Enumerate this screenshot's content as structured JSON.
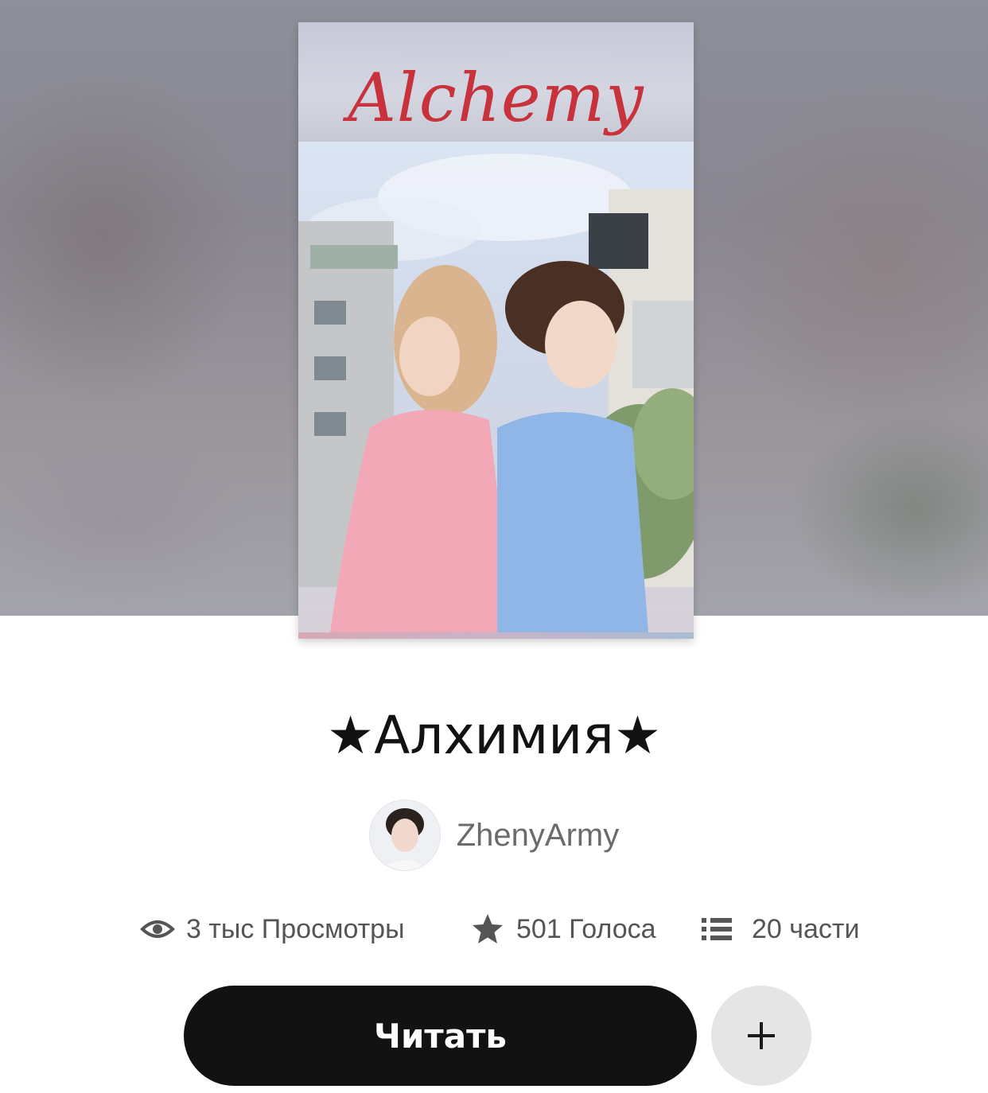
{
  "cover": {
    "title_art": "Alchemy"
  },
  "story": {
    "title": "★Алхимия★"
  },
  "author": {
    "name": "ZhenyArmy"
  },
  "stats": {
    "views": "3 тыс Просмотры",
    "votes": "501 Голоса",
    "parts": "20 части"
  },
  "actions": {
    "read_label": "Читать",
    "add_label": "+"
  },
  "colors": {
    "button_dark": "#121212",
    "button_light": "#e5e5e6",
    "cover_title": "#c8323a",
    "stat_text": "#555555"
  },
  "icons": {
    "views": "eye-icon",
    "votes": "star-icon",
    "parts": "list-icon",
    "add": "plus-icon"
  }
}
